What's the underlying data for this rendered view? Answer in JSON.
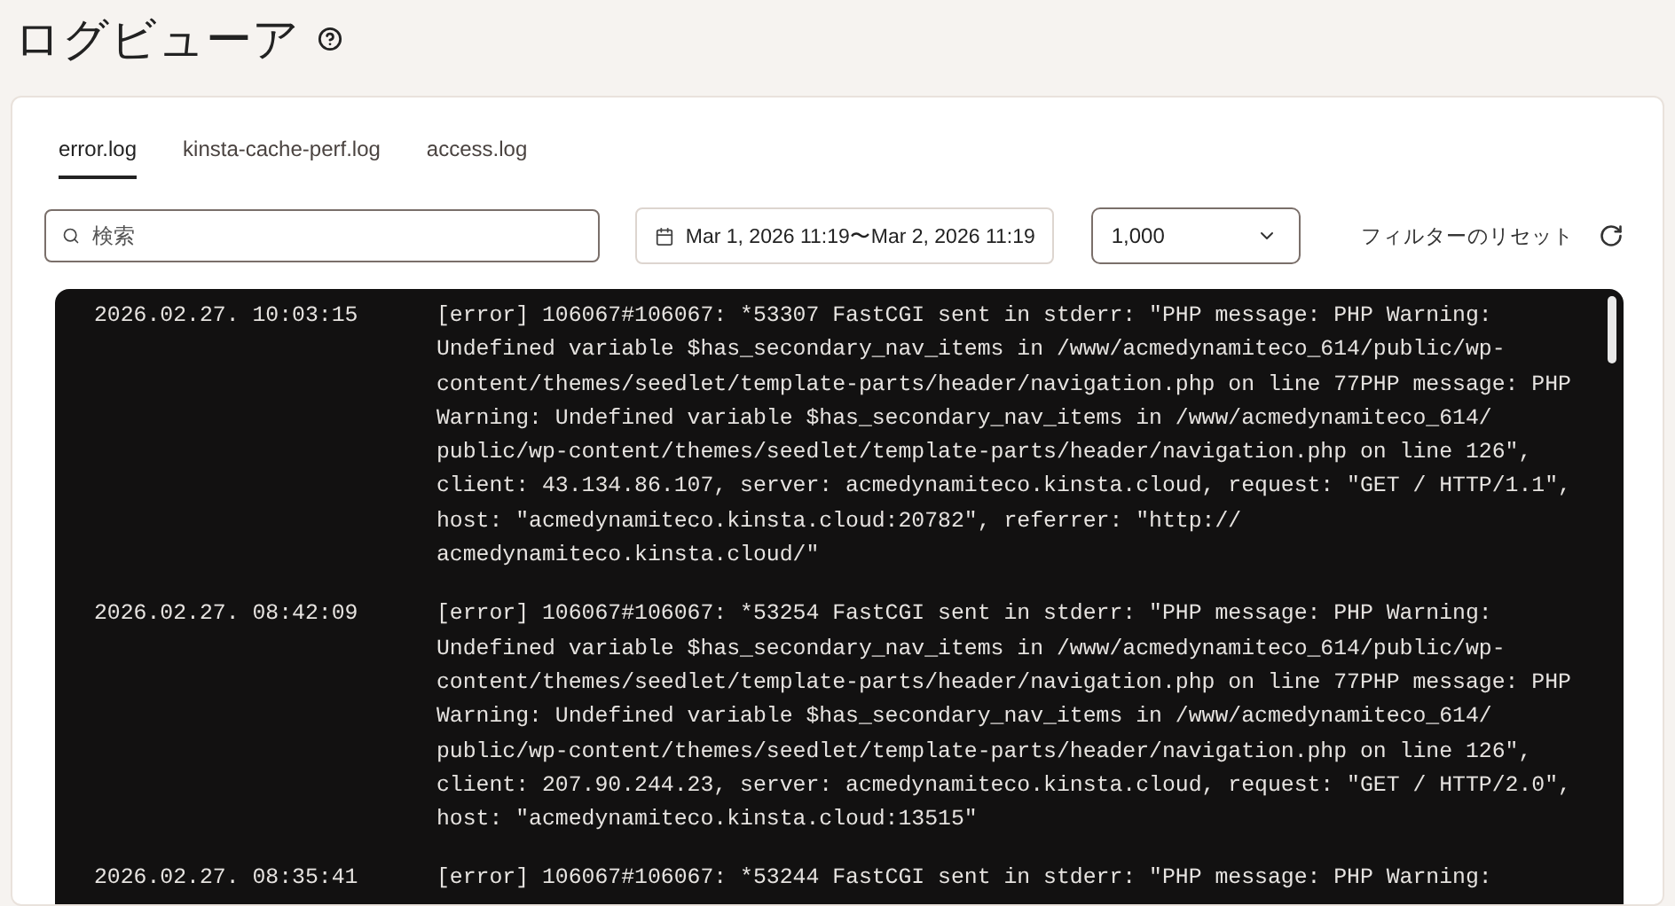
{
  "page": {
    "title": "ログビューア"
  },
  "tabs": [
    {
      "label": "error.log",
      "selected": true
    },
    {
      "label": "kinsta-cache-perf.log",
      "selected": false
    },
    {
      "label": "access.log",
      "selected": false
    }
  ],
  "filters": {
    "search": {
      "placeholder": "検索"
    },
    "date_range": "Mar 1, 2026 11:19〜Mar 2, 2026 11:19",
    "limit": "1,000",
    "reset": "フィルターのリセット"
  },
  "log_entries": [
    {
      "time": "2026.02.27. 10:03:15",
      "lines": [
        "[error] 106067#106067: *53307 FastCGI sent in stderr: \"PHP message: PHP Warning:",
        "Undefined variable $has_secondary_nav_items in /www/acmedynamiteco_614/public/wp-",
        "content/themes/seedlet/template-parts/header/navigation.php on line 77PHP message: PHP",
        "Warning: Undefined variable $has_secondary_nav_items in /www/acmedynamiteco_614/",
        "public/wp-content/themes/seedlet/template-parts/header/navigation.php on line 126\",",
        "client: 43.134.86.107, server: acmedynamiteco.kinsta.cloud, request: \"GET / HTTP/1.1\",",
        "host: \"acmedynamiteco.kinsta.cloud:20782\", referrer: \"http://",
        "acmedynamiteco.kinsta.cloud/\""
      ]
    },
    {
      "time": "2026.02.27. 08:42:09",
      "lines": [
        "[error] 106067#106067: *53254 FastCGI sent in stderr: \"PHP message: PHP Warning:",
        "Undefined variable $has_secondary_nav_items in /www/acmedynamiteco_614/public/wp-",
        "content/themes/seedlet/template-parts/header/navigation.php on line 77PHP message: PHP",
        "Warning: Undefined variable $has_secondary_nav_items in /www/acmedynamiteco_614/",
        "public/wp-content/themes/seedlet/template-parts/header/navigation.php on line 126\",",
        "client: 207.90.244.23, server: acmedynamiteco.kinsta.cloud, request: \"GET / HTTP/2.0\",",
        "host: \"acmedynamiteco.kinsta.cloud:13515\""
      ]
    },
    {
      "time": "2026.02.27. 08:35:41",
      "lines": [
        "[error] 106067#106067: *53244 FastCGI sent in stderr: \"PHP message: PHP Warning:"
      ]
    }
  ]
}
